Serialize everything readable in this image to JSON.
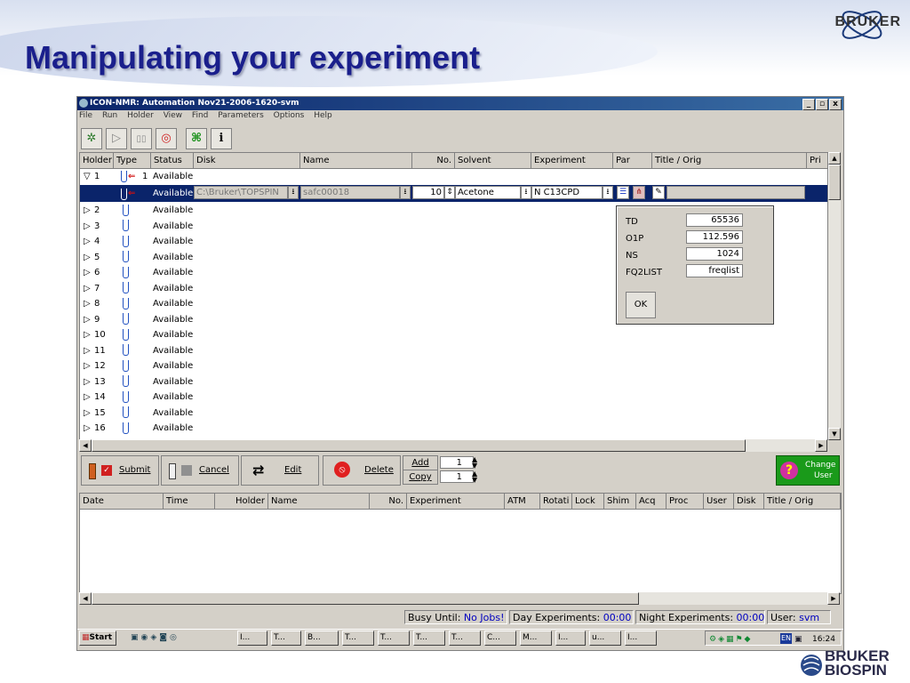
{
  "slide": {
    "title": "Manipulating your experiment",
    "logo_top_text": "BRUKER",
    "logo_bottom_line1": "BRUKER",
    "logo_bottom_line2": "BIOSPIN"
  },
  "window": {
    "title": "ICON-NMR: Automation Nov21-2006-1620-svm",
    "controls": [
      "_",
      "▫",
      "x"
    ],
    "menu": [
      "File",
      "Run",
      "Holder",
      "View",
      "Find",
      "Parameters",
      "Options",
      "Help"
    ]
  },
  "toolbar": {
    "icons": [
      "config-icon",
      "play-icon",
      "pause-icon",
      "stop-icon",
      "network-icon",
      "info-icon"
    ],
    "info_label": "i"
  },
  "sample_table": {
    "columns": [
      "Holder",
      "Type",
      "Status",
      "Disk",
      "Name",
      "No.",
      "Solvent",
      "Experiment",
      "Par",
      "Title / Orig",
      "Pri"
    ],
    "expanded_row": {
      "holder": "1",
      "count": "1",
      "status": "Available"
    },
    "selected_row": {
      "status": "Available",
      "disk": "C:\\Bruker\\TOPSPIN",
      "name": "safc00018",
      "no": "10",
      "solvent": "Acetone",
      "experiment": "N C13CPD"
    },
    "rows": [
      {
        "holder": "2",
        "status": "Available"
      },
      {
        "holder": "3",
        "status": "Available"
      },
      {
        "holder": "4",
        "status": "Available"
      },
      {
        "holder": "5",
        "status": "Available"
      },
      {
        "holder": "6",
        "status": "Available"
      },
      {
        "holder": "7",
        "status": "Available"
      },
      {
        "holder": "8",
        "status": "Available"
      },
      {
        "holder": "9",
        "status": "Available"
      },
      {
        "holder": "10",
        "status": "Available"
      },
      {
        "holder": "11",
        "status": "Available"
      },
      {
        "holder": "12",
        "status": "Available"
      },
      {
        "holder": "13",
        "status": "Available"
      },
      {
        "holder": "14",
        "status": "Available"
      },
      {
        "holder": "15",
        "status": "Available"
      },
      {
        "holder": "16",
        "status": "Available"
      }
    ]
  },
  "par_popup": {
    "params": [
      {
        "label": "TD",
        "value": "65536"
      },
      {
        "label": "O1P",
        "value": "112.596"
      },
      {
        "label": "NS",
        "value": "1024"
      },
      {
        "label": "FQ2LIST",
        "value": "freqlist"
      }
    ],
    "ok_label": "OK"
  },
  "actions": {
    "submit": "Submit",
    "cancel": "Cancel",
    "edit": "Edit",
    "delete": "Delete",
    "add": "Add",
    "copy": "Copy",
    "add_value": "1",
    "copy_value": "1",
    "change_user_line1": "Change",
    "change_user_line2": "User"
  },
  "queue_table": {
    "columns": [
      "Date",
      "Time",
      "Holder",
      "Name",
      "No.",
      "Experiment",
      "ATM",
      "Rotati",
      "Lock",
      "Shim",
      "Acq",
      "Proc",
      "User",
      "Disk",
      "Title / Orig"
    ]
  },
  "status_bar": {
    "busy_label": "Busy Until:",
    "busy_value": "No Jobs!",
    "day_label": "Day Experiments:",
    "day_value": "00:00",
    "night_label": "Night Experiments:",
    "night_value": "00:00",
    "user_label": "User:",
    "user_value": "svm"
  },
  "taskbar": {
    "start": "Start",
    "tasks": [
      "I...",
      "T...",
      "B...",
      "T...",
      "T...",
      "T...",
      "T...",
      "C...",
      "M...",
      "I...",
      "u...",
      "I..."
    ],
    "clock": "16:24",
    "lang": "EN"
  },
  "colors": {
    "title_blue": "#1a1f8c",
    "selection": "#0a246a",
    "status_value": "#0000c0"
  }
}
